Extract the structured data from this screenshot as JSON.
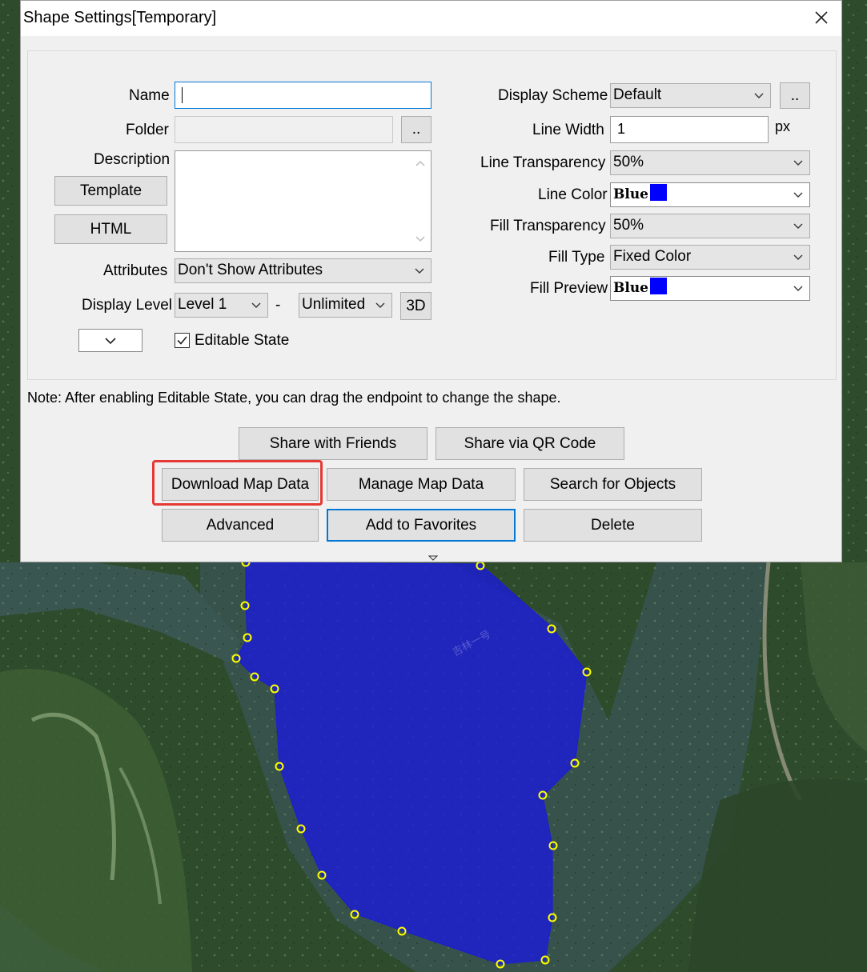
{
  "window": {
    "title": "Shape Settings[Temporary]"
  },
  "left": {
    "name_label": "Name",
    "name_value": "",
    "folder_label": "Folder",
    "folder_value": "",
    "folder_browse": "..",
    "description_label": "Description",
    "template_button": "Template",
    "html_button": "HTML",
    "attributes_label": "Attributes",
    "attributes_value": "Don't Show Attributes",
    "display_level_label": "Display Level",
    "level_from": "Level 1",
    "level_sep": "-",
    "level_to": "Unlimited",
    "btn_3d": "3D",
    "editable_label": "Editable State",
    "editable_checked": true
  },
  "right": {
    "display_scheme_label": "Display Scheme",
    "display_scheme_value": "Default",
    "scheme_browse": "..",
    "line_width_label": "Line Width",
    "line_width_value": "1",
    "line_width_unit": "px",
    "line_transparency_label": "Line Transparency",
    "line_transparency_value": "50%",
    "line_color_label": "Line Color",
    "line_color_value": "Blue",
    "fill_transparency_label": "Fill Transparency",
    "fill_transparency_value": "50%",
    "fill_type_label": "Fill Type",
    "fill_type_value": "Fixed Color",
    "fill_preview_label": "Fill Preview",
    "fill_preview_value": "Blue"
  },
  "note": "Note: After enabling Editable State, you can drag the endpoint to change the shape.",
  "buttons": {
    "share_friends": "Share with Friends",
    "share_qr": "Share via QR Code",
    "download_map": "Download Map Data",
    "manage_map": "Manage Map Data",
    "search_objects": "Search for Objects",
    "advanced": "Advanced",
    "add_favorites": "Add to Favorites",
    "delete": "Delete"
  },
  "map": {
    "road_label": "吉林一号"
  },
  "colors": {
    "swatch": "#0000ff",
    "accent": "#0078d7",
    "highlight": "#e53935",
    "polygon_fill": "#1a1adc"
  }
}
